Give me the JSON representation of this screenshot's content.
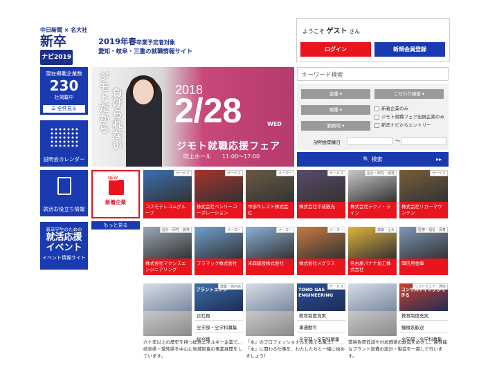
{
  "header": {
    "logo_top": "中日新聞 × 名大社",
    "logo_main": "新卒",
    "logo_navi": "ナビ2019",
    "tagline1_a": "2019年春",
    "tagline1_b": "卒業予定者対象",
    "tagline2": "愛知・岐阜・三重の就職情報サイト"
  },
  "login": {
    "welcome_a": "ようこそ",
    "welcome_name": "ゲスト",
    "welcome_b": "さん",
    "login_label": "ログイン",
    "register_label": "新規会員登録"
  },
  "sidebar": {
    "count_title": "現在掲載企業数",
    "count_value": "230",
    "count_suffix": "社掲載中",
    "all_label": "全件見る",
    "calendar_label": "説明会カレンダー",
    "info_label": "就活お役立ち情報",
    "event_top": "新卒学生のための",
    "event_line1": "就活応援",
    "event_line2": "イベント",
    "event_label": "イベント情報サイト"
  },
  "banner": {
    "v1": "ジモトだから",
    "v2": "負けられない",
    "year": "2018",
    "date": "2/28",
    "dow": "WED",
    "fair": "ジモト就職応援フェア",
    "hall": "吹上ホール　　11:00～17:00"
  },
  "search": {
    "keyword_placeholder": "キーワード検索",
    "industry": "業種",
    "job": "職種",
    "location": "勤務地",
    "kodawari": "こだわり検索",
    "check1": "新着企業のみ",
    "check2": "ジモト就職フェア出展企業のみ",
    "check3": "新卒ナビからエントリー",
    "date_label": "説明会開催日",
    "tilde": "～",
    "search_label": "検索",
    "arrows": "▸▸"
  },
  "newtile": {
    "badge": "NEW",
    "label": "新着企業",
    "more": "もっと見る"
  },
  "tiles": [
    {
      "cat": "サービス",
      "name": "コスモテレコムグループ",
      "color": "#3a6fb0"
    },
    {
      "cat": "サービス",
      "name": "株式会社ベンリーコーポレーション",
      "color": "#a8322a"
    },
    {
      "cat": "メーカー",
      "name": "中部キレスト株式会社",
      "color": "#6b5a44"
    },
    {
      "cat": "サービス",
      "name": "株式会社平成観光",
      "color": "#5a4a6c"
    },
    {
      "cat": "設計・研究・開発",
      "name": "株式会社テクノ・ライン",
      "color": "#c9c9c9"
    },
    {
      "cat": "サービス",
      "name": "株式会社リカーマウンテン",
      "color": "#7a5d3a"
    },
    {
      "cat": "設計・研究・開発",
      "name": "株式会社マクシスエンジニアリング",
      "color": "#9aa8b4"
    },
    {
      "cat": "メーカー",
      "name": "プラマック株式会社",
      "color": "#6ea0d0"
    },
    {
      "cat": "メーカー",
      "name": "米興建設株式会社",
      "color": "#8ab0d8"
    },
    {
      "cat": "メーカー",
      "name": "株式会社メグラス",
      "color": "#c77a44"
    },
    {
      "cat": "建築・土木",
      "name": "名古屋バナナ加工株式会社",
      "color": "#e2b33a"
    },
    {
      "cat": "医療・福祉・保育",
      "name": "聞信用金庫",
      "color": "#7d96b8"
    }
  ],
  "cards": [
    {
      "cat": "建築・高円派",
      "rows": [
        "正社員",
        "全学部・全学科募集",
        "総合職"
      ],
      "color": "#3c6fa8"
    },
    {
      "cat": "サービス",
      "rows": [
        "教育制度充実",
        "車通勤可",
        "全学部・全学科募集"
      ],
      "color": "#2a4f9a"
    },
    {
      "cat": "ソフトウェア・通信",
      "rows": [
        "教育制度充実",
        "機械系歓迎",
        "全学部・全学科募集"
      ],
      "color": "#c9412f"
    }
  ],
  "card_titles": [
    "プラントエンジ",
    "TOHO GAS ENGINEERING",
    "コンサルティングができる"
  ],
  "descs": [
    "六十年以上の歴史を持つ総合エネルギー企業で、岐阜県・愛知県を中心に地域密着の事業展開をしています。",
    "「水」のプロフェッショナルを育てる風土！「水」に関わる仕事を、わたしたちと一緒に始めましょう！",
    "環境負荷低減や付加価値の創造をめざし、高性能なプラント設備の設計・製造を一貫して行います。"
  ]
}
